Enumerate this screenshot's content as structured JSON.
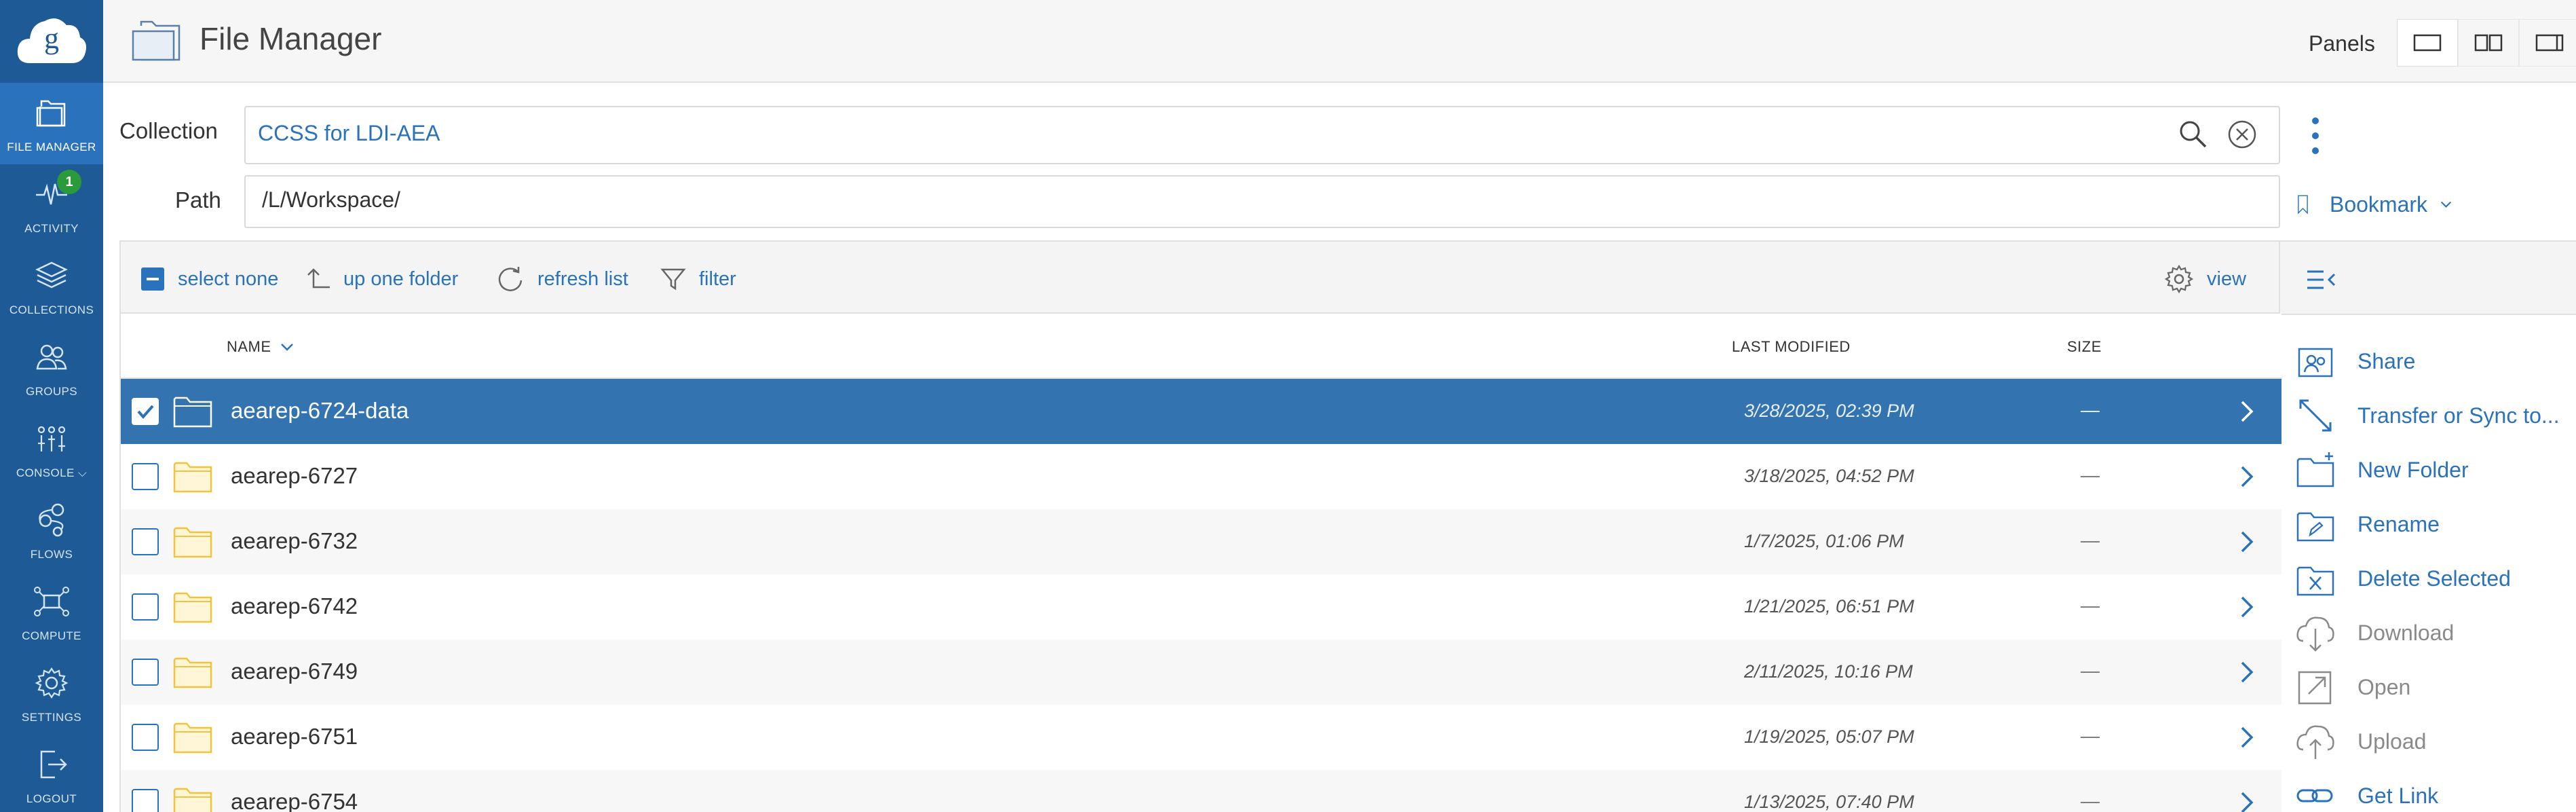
{
  "app": {
    "title": "File Manager"
  },
  "nav": {
    "items": [
      {
        "label": "FILE MANAGER",
        "icon": "file-manager-icon"
      },
      {
        "label": "ACTIVITY",
        "icon": "activity-icon",
        "badge": "1"
      },
      {
        "label": "COLLECTIONS",
        "icon": "collections-icon"
      },
      {
        "label": "GROUPS",
        "icon": "groups-icon"
      },
      {
        "label": "CONSOLE ⌵",
        "icon": "console-icon"
      },
      {
        "label": "FLOWS",
        "icon": "flows-icon"
      },
      {
        "label": "COMPUTE",
        "icon": "compute-icon"
      },
      {
        "label": "SETTINGS",
        "icon": "gear-icon"
      },
      {
        "label": "LOGOUT",
        "icon": "logout-icon"
      }
    ]
  },
  "header": {
    "panels_label": "Panels"
  },
  "collection": {
    "label": "Collection",
    "value": "CCSS for LDI-AEA"
  },
  "path": {
    "label": "Path",
    "value": "/L/Workspace/"
  },
  "bookmark": {
    "label": "Bookmark"
  },
  "toolbar": {
    "select_none": "select none",
    "up_one_folder": "up one folder",
    "refresh_list": "refresh list",
    "filter": "filter",
    "view": "view"
  },
  "table": {
    "columns": {
      "name": "NAME",
      "last_modified": "LAST MODIFIED",
      "size": "SIZE"
    },
    "rows": [
      {
        "name": "aearep-6724-data",
        "modified": "3/28/2025, 02:39 PM",
        "size": "—",
        "selected": true
      },
      {
        "name": "aearep-6727",
        "modified": "3/18/2025, 04:52 PM",
        "size": "—",
        "selected": false
      },
      {
        "name": "aearep-6732",
        "modified": "1/7/2025, 01:06 PM",
        "size": "—",
        "selected": false
      },
      {
        "name": "aearep-6742",
        "modified": "1/21/2025, 06:51 PM",
        "size": "—",
        "selected": false
      },
      {
        "name": "aearep-6749",
        "modified": "2/11/2025, 10:16 PM",
        "size": "—",
        "selected": false
      },
      {
        "name": "aearep-6751",
        "modified": "1/19/2025, 05:07 PM",
        "size": "—",
        "selected": false
      },
      {
        "name": "aearep-6754",
        "modified": "1/13/2025, 07:40 PM",
        "size": "—",
        "selected": false
      }
    ]
  },
  "actions": [
    {
      "label": "Share",
      "enabled": true,
      "icon": "share-icon"
    },
    {
      "label": "Transfer or Sync to...",
      "enabled": true,
      "icon": "transfer-icon"
    },
    {
      "label": "New Folder",
      "enabled": true,
      "icon": "new-folder-icon"
    },
    {
      "label": "Rename",
      "enabled": true,
      "icon": "rename-icon"
    },
    {
      "label": "Delete Selected",
      "enabled": true,
      "icon": "delete-icon"
    },
    {
      "label": "Download",
      "enabled": false,
      "icon": "download-icon"
    },
    {
      "label": "Open",
      "enabled": false,
      "icon": "open-icon"
    },
    {
      "label": "Upload",
      "enabled": false,
      "icon": "upload-icon"
    },
    {
      "label": "Get Link",
      "enabled": true,
      "icon": "link-icon"
    }
  ],
  "colors": {
    "nav_bg": "#1e5b96",
    "nav_active": "#2a72bb",
    "accent": "#2a72bb",
    "selected_row": "#3373b0",
    "folder": "#f3c33c",
    "badge": "#2a9a3b"
  }
}
